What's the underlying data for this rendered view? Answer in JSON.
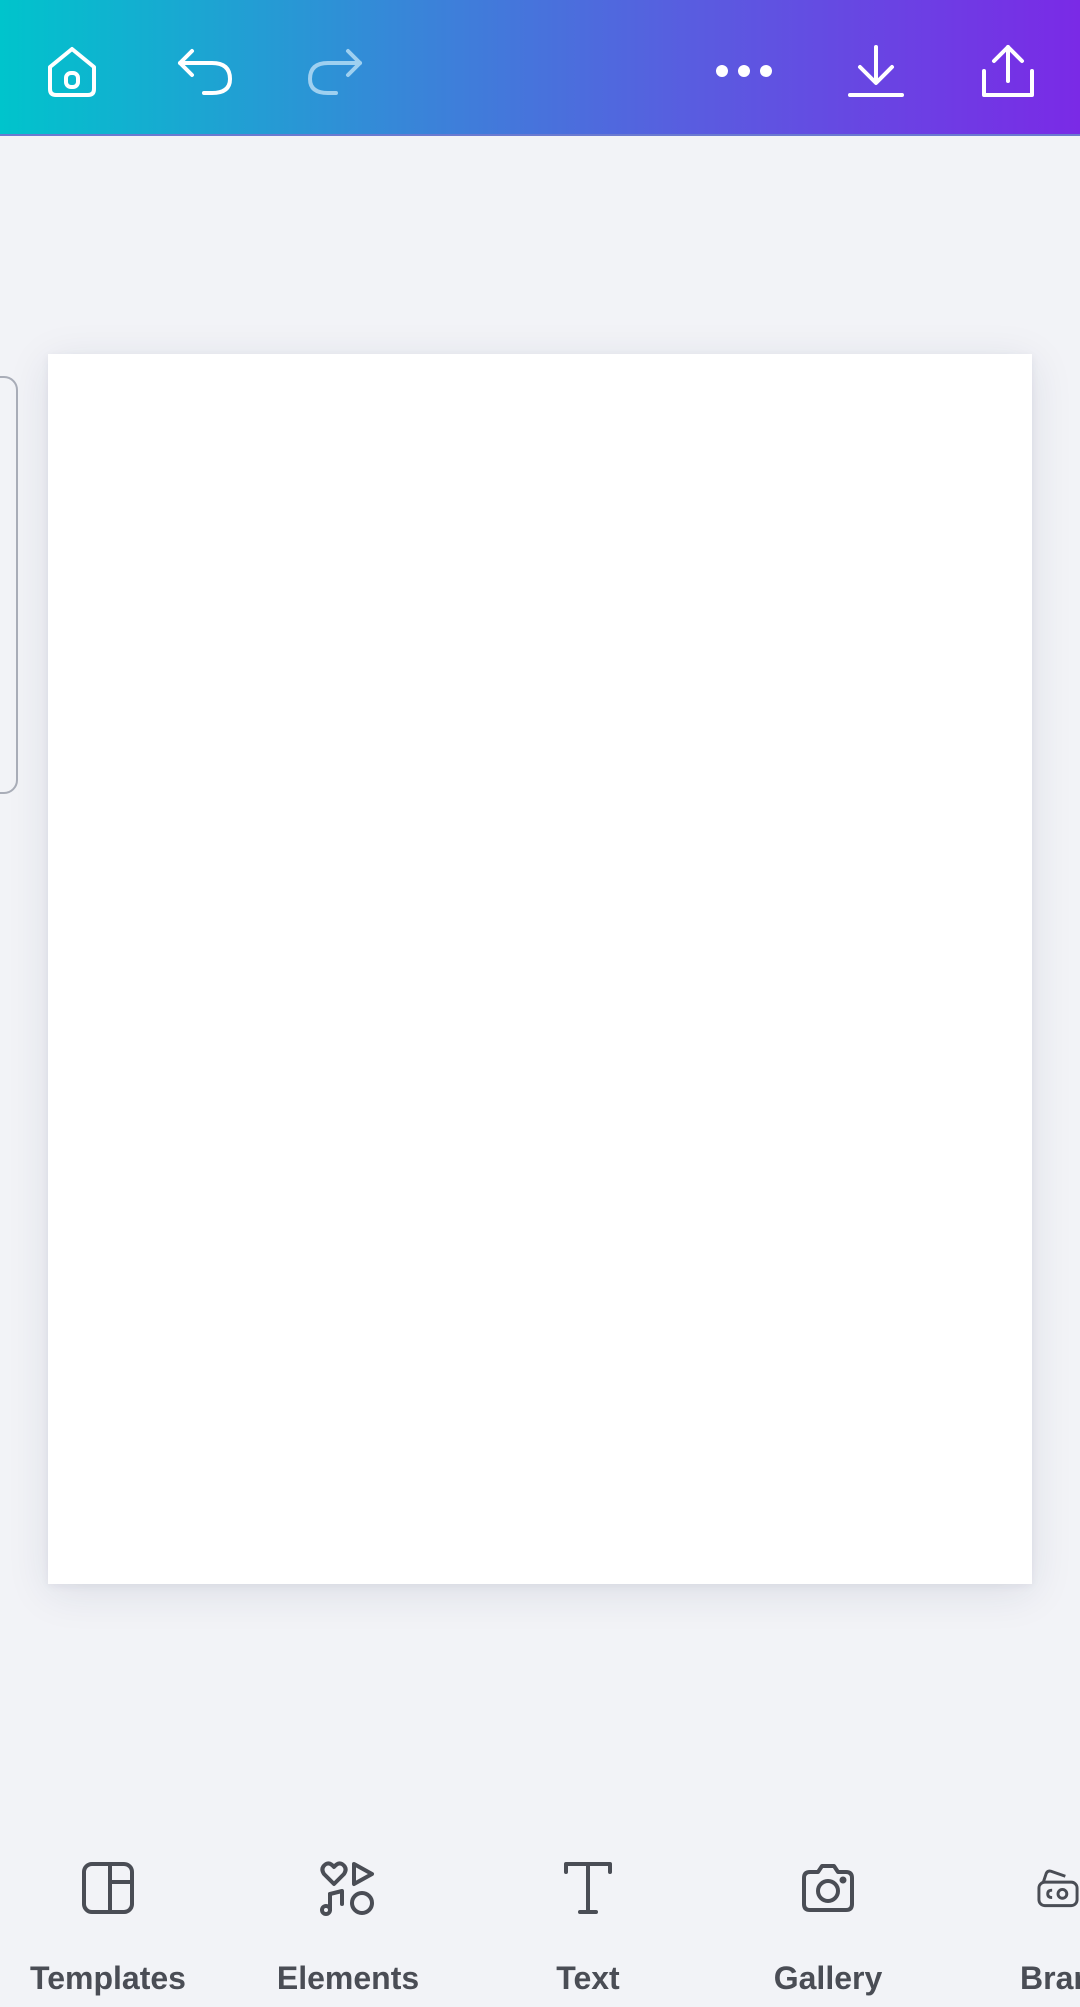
{
  "bottom_nav": [
    {
      "label": "Templates",
      "icon": "templates-icon"
    },
    {
      "label": "Elements",
      "icon": "elements-icon"
    },
    {
      "label": "Text",
      "icon": "text-icon"
    },
    {
      "label": "Gallery",
      "icon": "camera-icon"
    },
    {
      "label": "Bran",
      "icon": "brand-kit-icon"
    }
  ],
  "toolbar": {
    "icons": [
      "home-icon",
      "undo-icon",
      "redo-icon",
      "more-icon",
      "download-icon",
      "share-icon"
    ]
  },
  "colors": {
    "gradient_start": "#00c4cc",
    "gradient_end": "#7a2ae6",
    "canvas_bg": "#f2f3f7",
    "label_color": "#4a4d55"
  }
}
